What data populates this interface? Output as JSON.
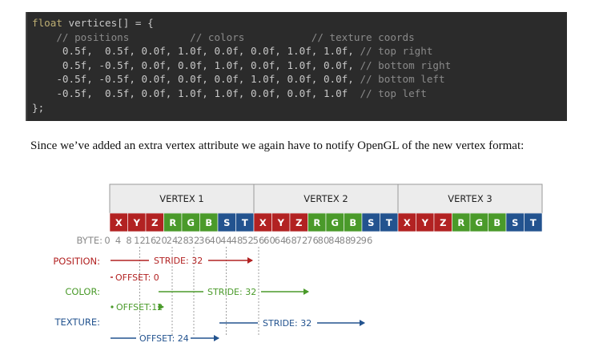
{
  "code": {
    "line1_keyword": "float",
    "line1_rest": " vertices[] = {",
    "comment_header": "    // positions          // colors           // texture coords",
    "rows": [
      {
        "values": "     0.5f,  0.5f, 0.0f, 1.0f, 0.0f, 0.0f, 1.0f, 1.0f, ",
        "comment": "// top right"
      },
      {
        "values": "     0.5f, -0.5f, 0.0f, 0.0f, 1.0f, 0.0f, 1.0f, 0.0f, ",
        "comment": "// bottom right"
      },
      {
        "values": "    -0.5f, -0.5f, 0.0f, 0.0f, 0.0f, 1.0f, 0.0f, 0.0f, ",
        "comment": "// bottom left"
      },
      {
        "values": "    -0.5f,  0.5f, 0.0f, 1.0f, 1.0f, 0.0f, 0.0f, 1.0f  ",
        "comment": "// top left"
      }
    ],
    "closing": "};"
  },
  "paragraph": "Since we’ve added an extra vertex attribute we again have to notify OpenGL of the new vertex format:",
  "diagram": {
    "vertex_headers": [
      "VERTEX 1",
      "VERTEX 2",
      "VERTEX 3"
    ],
    "attribute_letters": [
      "X",
      "Y",
      "Z",
      "R",
      "G",
      "B",
      "S",
      "T"
    ],
    "attribute_colors": [
      "#b22222",
      "#b22222",
      "#b22222",
      "#4a9a2a",
      "#4a9a2a",
      "#4a9a2a",
      "#23538f",
      "#23538f"
    ],
    "byte_label": "BYTE:",
    "byte_offsets": [
      "0",
      "4",
      "8",
      "12",
      "16",
      "20",
      "24",
      "28",
      "32",
      "36",
      "40",
      "44",
      "48",
      "52",
      "56",
      "60",
      "64",
      "68",
      "72",
      "76",
      "80",
      "84",
      "88",
      "92",
      "96"
    ],
    "row_labels": {
      "position": "POSITION:",
      "color": "COLOR:",
      "texture": "TEXTURE:"
    },
    "position_stride": "STRIDE: 32",
    "position_offset": "OFFSET: 0",
    "color_stride": "STRIDE: 32",
    "color_offset": "OFFSET:12",
    "texture_stride": "STRIDE: 32",
    "texture_offset": "OFFSET: 24",
    "colors": {
      "position": "#b22222",
      "color": "#4a9a2a",
      "texture": "#23538f"
    }
  }
}
